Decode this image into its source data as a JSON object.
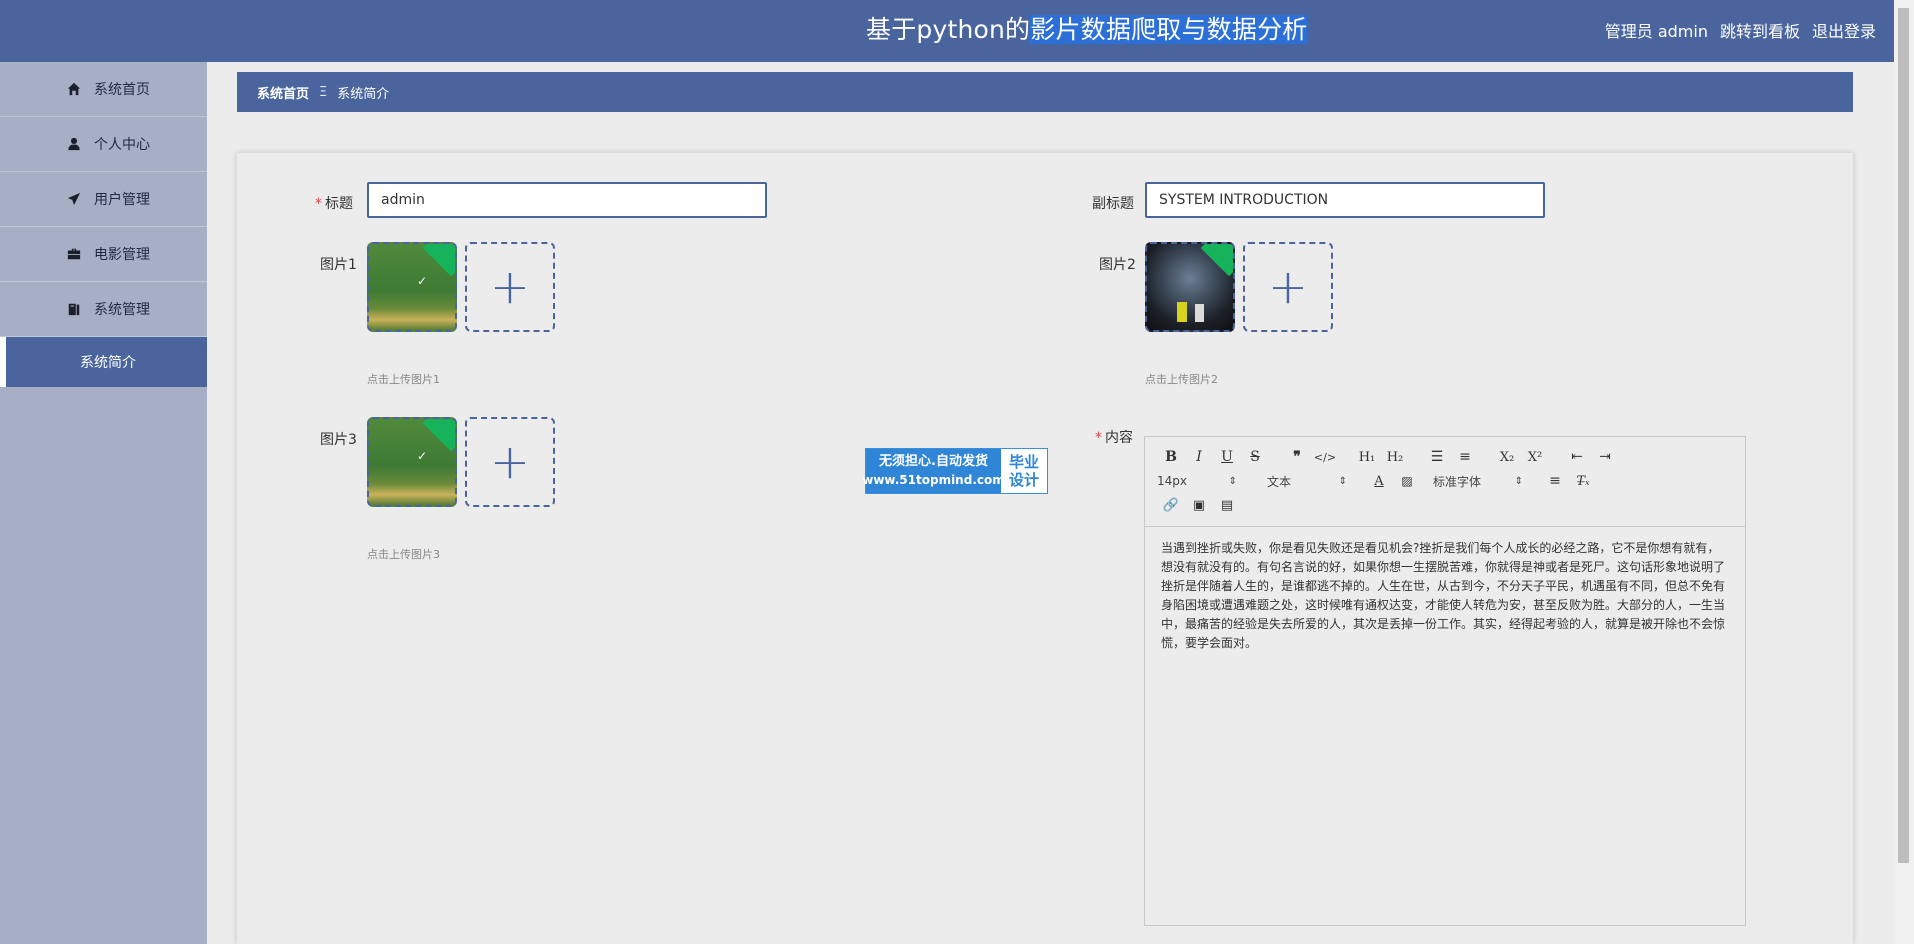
{
  "header": {
    "title_pre": "基于python的",
    "title_hl": "影片数据爬取与数据分析",
    "admin": "管理员 admin",
    "dashboard_link": "跳转到看板",
    "logout": "退出登录"
  },
  "sidebar": {
    "items": [
      {
        "label": "系统首页",
        "icon": "home-icon"
      },
      {
        "label": "个人中心",
        "icon": "user-icon"
      },
      {
        "label": "用户管理",
        "icon": "send-icon"
      },
      {
        "label": "电影管理",
        "icon": "briefcase-icon"
      },
      {
        "label": "系统管理",
        "icon": "book-icon"
      }
    ],
    "active_sub": "系统简介"
  },
  "breadcrumb": {
    "home": "系统首页",
    "sep": "Ξ",
    "current": "系统简介"
  },
  "form": {
    "title_label": "标题",
    "title_value": "admin",
    "subtitle_label": "副标题",
    "subtitle_value": "SYSTEM INTRODUCTION",
    "pic1_label": "图片1",
    "pic1_hint": "点击上传图片1",
    "pic2_label": "图片2",
    "pic2_hint": "点击上传图片2",
    "pic3_label": "图片3",
    "pic3_hint": "点击上传图片3",
    "content_label": "内容"
  },
  "editor": {
    "font_size": "14px",
    "block_type": "文本",
    "font_family": "标准字体",
    "content": "当遇到挫折或失败，你是看见失败还是看见机会?挫折是我们每个人成长的必经之路，它不是你想有就有，想没有就没有的。有句名言说的好，如果你想一生摆脱苦难，你就得是神或者是死尸。这句话形象地说明了挫折是伴随着人生的，是谁都逃不掉的。人生在世，从古到今，不分天子平民，机遇虽有不同，但总不免有身陷困境或遭遇难题之处，这时候唯有通权达变，才能使人转危为安，甚至反败为胜。大部分的人，一生当中，最痛苦的经验是失去所爱的人，其次是丢掉一份工作。其实，经得起考验的人，就算是被开除也不会惊慌，要学会面对。"
  },
  "watermark": {
    "line1": "无须担心.自动发货",
    "line2": "www.51topmind.com",
    "side1": "毕业",
    "side2": "设计"
  }
}
